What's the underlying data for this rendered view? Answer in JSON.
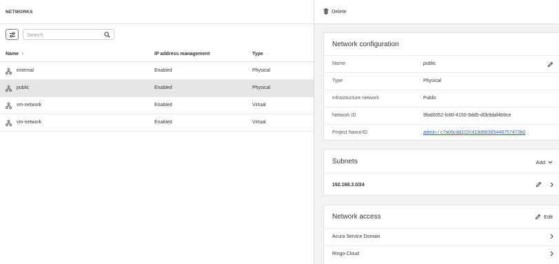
{
  "list": {
    "title": "NETWORKS",
    "search_placeholder": "Search",
    "columns": {
      "name": "Name",
      "ipam": "IP address management",
      "type": "Type"
    },
    "rows": [
      {
        "name": "external",
        "ipam": "Enabled",
        "type": "Physical",
        "selected": false
      },
      {
        "name": "public",
        "ipam": "Enabled",
        "type": "Physical",
        "selected": true
      },
      {
        "name": "vm-network",
        "ipam": "Enabled",
        "type": "Virtual",
        "selected": false
      },
      {
        "name": "vm-network",
        "ipam": "Enabled",
        "type": "Virtual",
        "selected": false
      }
    ]
  },
  "details": {
    "delete_label": "Delete",
    "config": {
      "title": "Network configuration",
      "fields": [
        {
          "label": "Name",
          "value": "public",
          "editable": true,
          "link": false
        },
        {
          "label": "Type",
          "value": "Physical",
          "editable": false,
          "link": false
        },
        {
          "label": "Infrastructure network",
          "value": "Public",
          "editable": false,
          "link": false
        },
        {
          "label": "Network ID",
          "value": "9fad0052-fc80-4150-9dd5-d0b9daf4b9ce",
          "editable": false,
          "link": false
        },
        {
          "label": "Project Name/ID",
          "value": "admin / c7a06cdd102c419d98365448757472b0",
          "editable": false,
          "link": true
        }
      ]
    },
    "subnets": {
      "title": "Subnets",
      "add_label": "Add",
      "items": [
        {
          "cidr": "192.168.3.0/24"
        }
      ]
    },
    "access": {
      "title": "Network access",
      "edit_label": "Edit",
      "items": [
        {
          "label": "Acura Service Domain"
        },
        {
          "label": "Ringo-Cloud"
        }
      ]
    }
  },
  "colors": {
    "selected_row": "#e6e6e6",
    "link": "#2d5da8",
    "panel_bg": "#f3f3f3"
  },
  "icons": [
    "filter-icon",
    "search-icon",
    "network-icon",
    "trash-icon",
    "pencil-icon",
    "chevron-down-icon",
    "chevron-right-icon"
  ]
}
